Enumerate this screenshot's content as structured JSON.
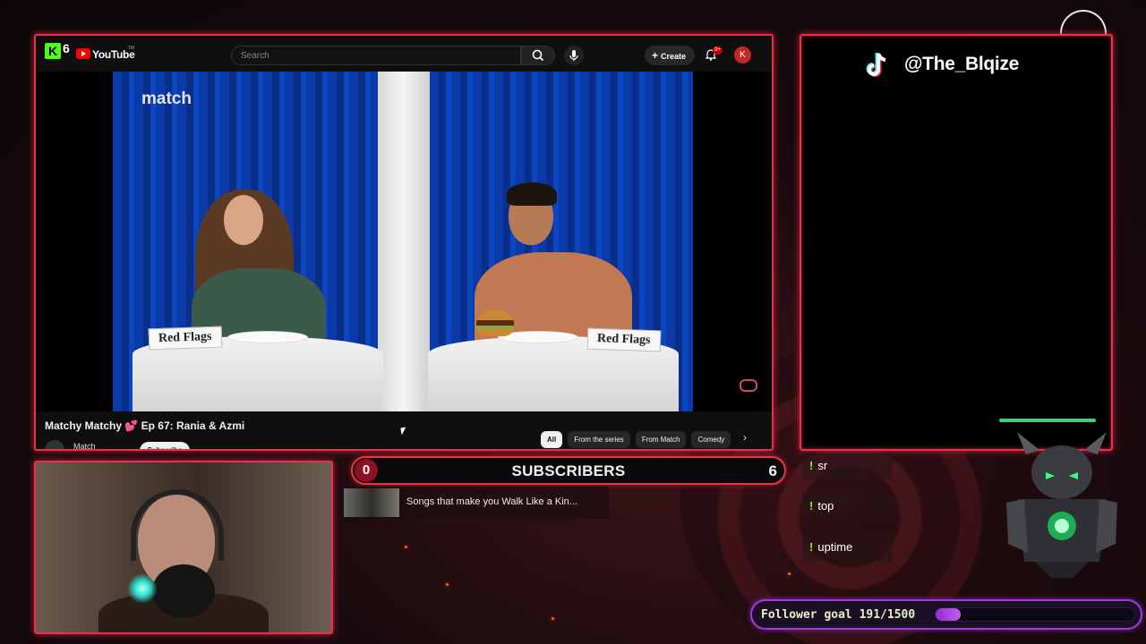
{
  "youtube": {
    "logo_number": "6",
    "brand": "YouTube",
    "brand_tm": "TM",
    "search_placeholder": "Search",
    "create_label": "Create",
    "notif_badge": "9+",
    "account_initial": "K",
    "video_logo": "match",
    "card_left": "Red Flags",
    "card_right": "Red Flags",
    "video_title": "Matchy Matchy 💕 Ep 67: Rania & Azmi",
    "channel_name": "Match",
    "subscribe_label": "Subscribe",
    "chips": [
      "All",
      "From the series",
      "From Match",
      "Comedy"
    ]
  },
  "tiktok": {
    "handle": "@The_Blqize"
  },
  "subscribers": {
    "left_count": "0",
    "label": "SUBSCRIBERS",
    "right_count": "6"
  },
  "now_playing": {
    "title": "Songs that make you Walk Like a Kin..."
  },
  "commands": [
    "sr",
    "top",
    "uptime"
  ],
  "follower_goal": {
    "text": "Follower goal 191/1500",
    "current": 191,
    "target": 1500
  },
  "colors": {
    "frame_red": "#e8324a",
    "goal_purple": "#a23ad8",
    "command_green": "#7cf23a",
    "youtube_red": "#ff0000",
    "kick_green": "#53fc18"
  }
}
